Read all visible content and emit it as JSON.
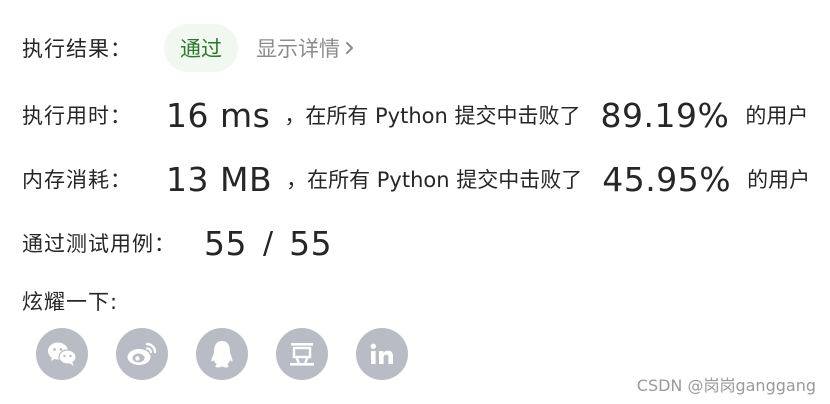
{
  "result": {
    "label": "执行结果：",
    "status": "通过",
    "details_link": "显示详情"
  },
  "runtime": {
    "label": "执行用时：",
    "value": "16 ms",
    "middle_text": "，在所有 Python 提交中击败了",
    "percent": "89.19%",
    "suffix": "的用户"
  },
  "memory": {
    "label": "内存消耗：",
    "value": "13 MB",
    "middle_text": "，在所有 Python 提交中击败了",
    "percent": "45.95%",
    "suffix": "的用户"
  },
  "test_cases": {
    "label": "通过测试用例：",
    "passed": "55",
    "slash": "/",
    "total": "55"
  },
  "share": {
    "label": "炫耀一下:",
    "buttons": [
      {
        "icon": "wechat-icon"
      },
      {
        "icon": "weibo-icon"
      },
      {
        "icon": "qq-icon"
      },
      {
        "icon": "douban-icon",
        "text": "豆"
      },
      {
        "icon": "linkedin-icon",
        "text": "in"
      }
    ]
  },
  "watermark": "CSDN @岗岗ganggang",
  "colors": {
    "badge_bg": "#f0f8ef",
    "badge_text": "#2b7a2b",
    "share_icon_bg": "#b9bcc4",
    "muted_text": "#8c8c8c"
  }
}
